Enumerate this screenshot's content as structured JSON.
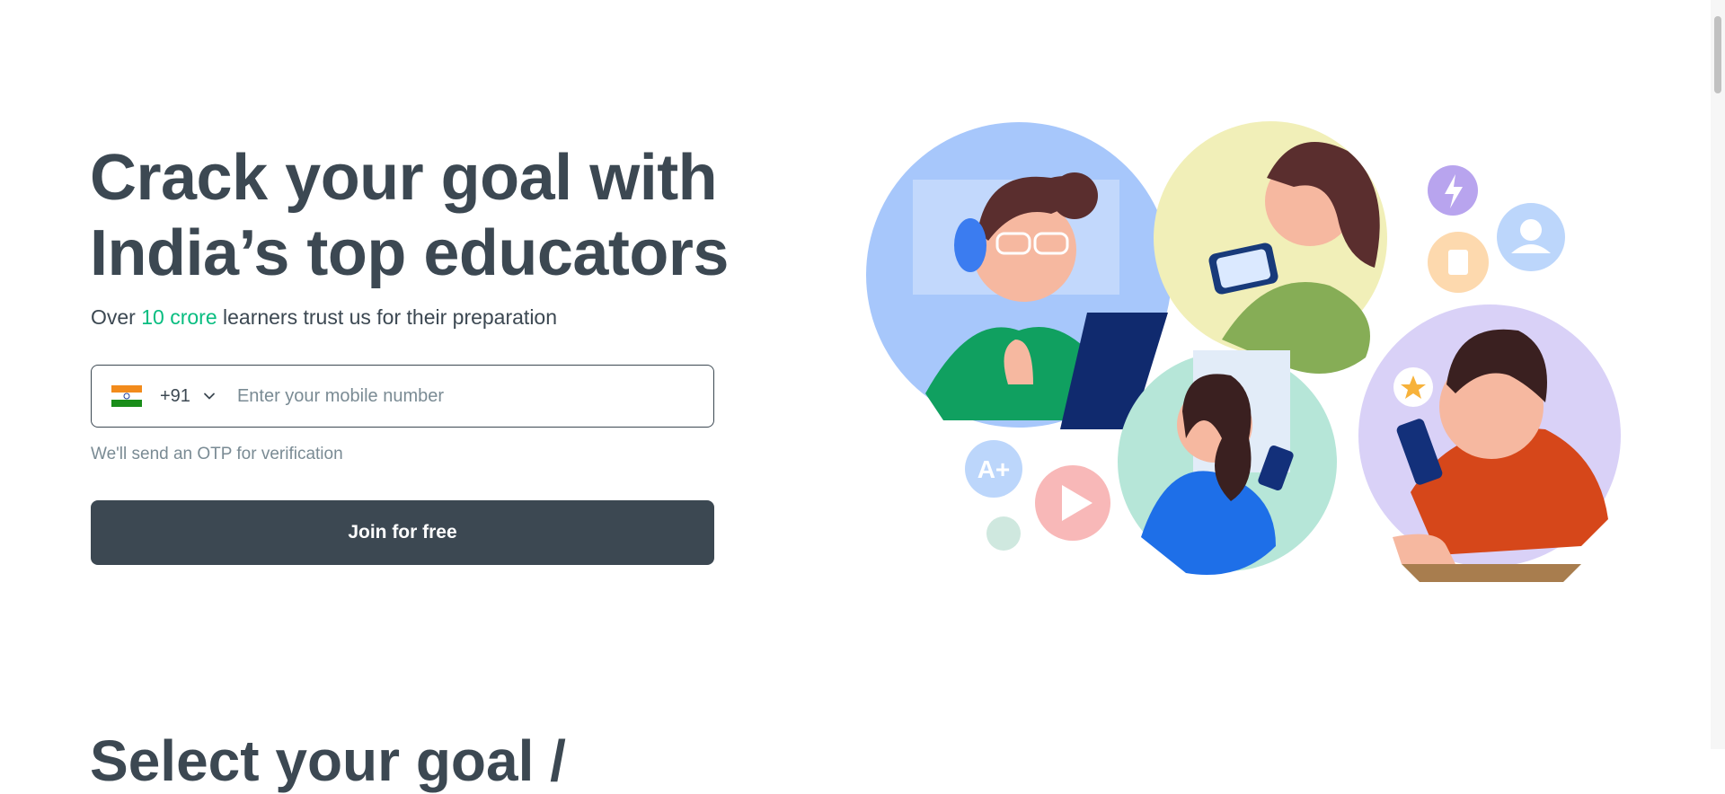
{
  "hero": {
    "title_line1": "Crack your goal with",
    "title_line2": "India’s top educators",
    "subtitle_before": "Over ",
    "subtitle_highlight": "10 crore",
    "subtitle_after": " learners trust us for their preparation"
  },
  "signup": {
    "country_code": "+91",
    "flag_icon": "india-flag-icon",
    "phone_placeholder": "Enter your mobile number",
    "phone_value": "",
    "otp_note": "We'll send an OTP for verification",
    "join_label": "Join for free"
  },
  "next_section": {
    "heading_partial": "Select your goal /"
  },
  "colors": {
    "text": "#3c4852",
    "accent": "#08bd80",
    "muted": "#7a8b94",
    "button_bg": "#3c4852"
  }
}
